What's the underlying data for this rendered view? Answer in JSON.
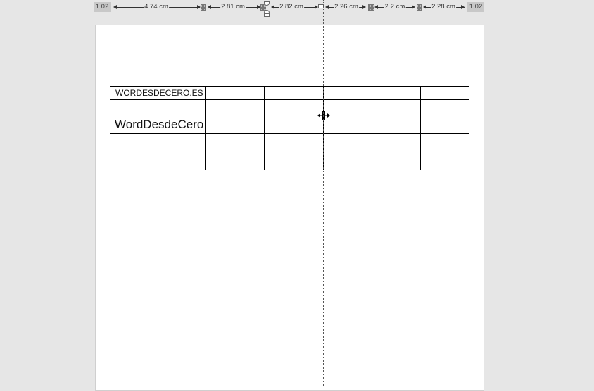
{
  "ruler": {
    "left_margin": "1.02",
    "right_margin": "1.02",
    "columns": [
      "4.74 cm",
      "2.81 cm",
      "2.82 cm",
      "2.26 cm",
      "2.2 cm",
      "2.28 cm"
    ]
  },
  "table": {
    "rows": [
      [
        "WORDESDECERO.ES",
        "",
        "",
        "",
        "",
        ""
      ],
      [
        "WordDesdeCero",
        "",
        "",
        "",
        "",
        ""
      ],
      [
        "",
        "",
        "",
        "",
        "",
        ""
      ]
    ]
  },
  "cursor": {
    "icon": "column-resize-cursor-icon"
  },
  "colors": {
    "workspace": "#e6e6e6",
    "page": "#ffffff",
    "table_border": "#000000",
    "ruler_margin": "#c8c8c8"
  }
}
